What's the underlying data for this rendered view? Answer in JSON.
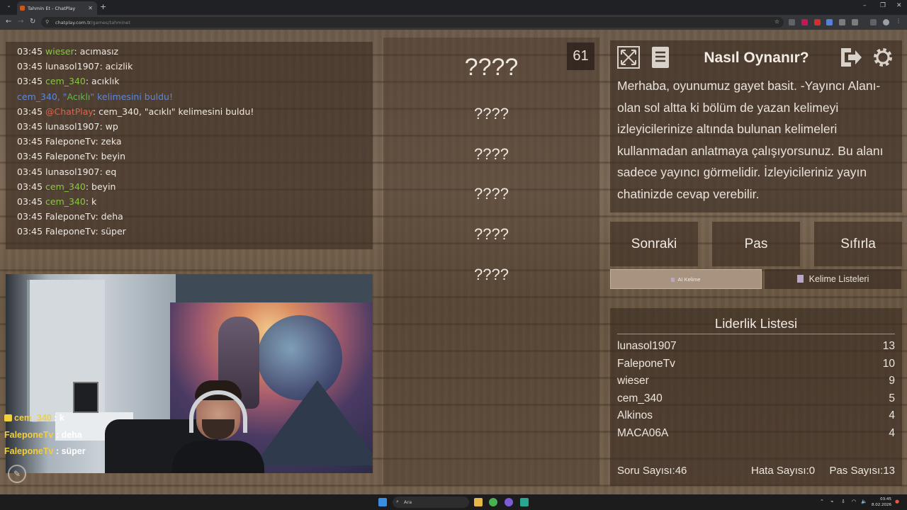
{
  "browser": {
    "tab_title": "Tahmin Et - ChatPlay",
    "url_host": "chatplay.com.tr",
    "url_path": "/games/tahminet",
    "min": "–",
    "max": "❐",
    "close": "✕"
  },
  "chat": {
    "lines": [
      {
        "time": "03:45",
        "user": "wieser",
        "color": "#8bc34a",
        "msg": ": acımasız"
      },
      {
        "time": "03:45",
        "user": "lunasol1907",
        "color": "#efe9e2",
        "msg": ": acizlik"
      },
      {
        "time": "03:45",
        "user": "cem_340",
        "color": "#8bc34a",
        "msg": ": acıklık"
      },
      {
        "time": "",
        "user": "",
        "color": "",
        "msg": ""
      },
      {
        "time": "03:45",
        "user": "@ChatPlay",
        "color": "#e0604a",
        "msg": ": cem_340, \"acıklı\" kelimesini buldu!"
      },
      {
        "time": "03:45",
        "user": "lunasol1907",
        "color": "#efe9e2",
        "msg": ": wp"
      },
      {
        "time": "03:45",
        "user": "FaleponeTv",
        "color": "#efe9e2",
        "msg": ": zeka"
      },
      {
        "time": "03:45",
        "user": "FaleponeTv",
        "color": "#efe9e2",
        "msg": ": beyin"
      },
      {
        "time": "03:45",
        "user": "lunasol1907",
        "color": "#efe9e2",
        "msg": ": eq"
      },
      {
        "time": "03:45",
        "user": "cem_340",
        "color": "#8bc34a",
        "msg": ": beyin"
      },
      {
        "time": "03:45",
        "user": "cem_340",
        "color": "#8bc34a",
        "msg": ": k"
      },
      {
        "time": "03:45",
        "user": "FaleponeTv",
        "color": "#efe9e2",
        "msg": ": deha"
      },
      {
        "time": "03:45",
        "user": "FaleponeTv",
        "color": "#efe9e2",
        "msg": ": süper"
      }
    ],
    "system_line": {
      "pre": "cem_340, \"",
      "word": "Acıklı",
      "post": "\" kelimesini buldu!"
    }
  },
  "overlay_chat": [
    {
      "user": "cem_340",
      "msg": " : k",
      "badge": true
    },
    {
      "user": "FaleponeTv",
      "msg": " : deha",
      "badge": false
    },
    {
      "user": "FaleponeTv",
      "msg": " : süper",
      "badge": false
    }
  ],
  "game": {
    "timer": "61",
    "main_word": "????",
    "sub_words": [
      "????",
      "????",
      "????",
      "????",
      "????"
    ]
  },
  "info": {
    "title": "Nasıl Oynanır?",
    "text": "Merhaba, oyunumuz gayet basit. -Yayıncı Alanı- olan sol altta ki bölüm de yazan kelimeyi izleyicilerinize altında bulunan kelimeleri kullanmadan anlatmaya çalışıyorsunuz. Bu alanı sadece yayıncı görmelidir. İzleyicileriniz yayın chatinizde cevap verebilir."
  },
  "actions": {
    "next": "Sonraki",
    "pass": "Pas",
    "reset": "Sıfırla"
  },
  "tabs": {
    "ai": "AI Kelime",
    "lists": "Kelime Listeleri"
  },
  "leaderboard": {
    "title": "Liderlik Listesi",
    "rows": [
      {
        "name": "lunasol1907",
        "score": "13"
      },
      {
        "name": "FaleponeTv",
        "score": "10"
      },
      {
        "name": "wieser",
        "score": "9"
      },
      {
        "name": "cem_340",
        "score": "5"
      },
      {
        "name": "Alkinos",
        "score": "4"
      },
      {
        "name": "MACA06A",
        "score": "4"
      }
    ],
    "stats": {
      "questions": "Soru Sayısı:46",
      "errors": "Hata Sayısı:0",
      "passes": "Pas Sayısı:13"
    }
  },
  "taskbar": {
    "search": "Ara",
    "time": "03:45",
    "date": "8.02.2026"
  }
}
